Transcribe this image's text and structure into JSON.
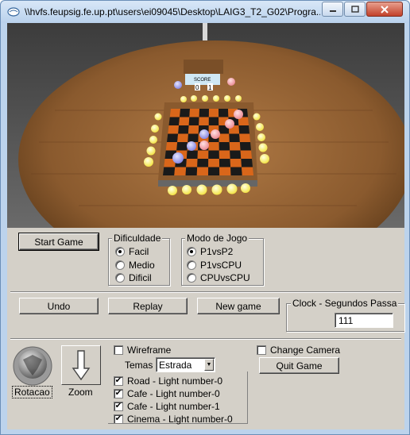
{
  "window": {
    "title": "\\\\hvfs.feupsig.fe.up.pt\\users\\ei09045\\Desktop\\LAIG3_T2_G02\\Progra..."
  },
  "scoreboard": {
    "label": "SCORE",
    "p1": "0",
    "p2": "1"
  },
  "controls": {
    "start_game": "Start Game",
    "undo": "Undo",
    "replay": "Replay",
    "new_game": "New game"
  },
  "difficulty": {
    "title": "Dificuldade",
    "options": [
      "Facil",
      "Medio",
      "Dificil"
    ],
    "selected": "Facil"
  },
  "mode": {
    "title": "Modo de Jogo",
    "options": [
      "P1vsP2",
      "P1vsCPU",
      "CPUvsCPU"
    ],
    "selected": "P1vsP2"
  },
  "clock": {
    "title": "Clock - Segundos Passa",
    "value": "111"
  },
  "camera": {
    "rotation_label": "Rotacao",
    "zoom_label": "Zoom",
    "change_camera_label": "Change Camera",
    "change_camera_checked": false,
    "quit_game": "Quit Game"
  },
  "display": {
    "wireframe_label": "Wireframe",
    "wireframe_checked": false,
    "themes_label": "Temas",
    "theme_value": "Estrada",
    "lights": [
      {
        "label": "Road - Light number-0",
        "checked": true
      },
      {
        "label": "Cafe - Light number-0",
        "checked": true
      },
      {
        "label": "Cafe - Light number-1",
        "checked": true
      },
      {
        "label": "Cinema - Light number-0",
        "checked": true
      }
    ]
  },
  "colors": {
    "window_frame": "#bcd3ec",
    "panel_bg": "#d4d0c8",
    "table_wood": "#8a5a2e",
    "board_orange": "#d9661a",
    "board_dark": "#1a1a1a",
    "piece_pink": "#f5a0a8",
    "piece_blue": "#a8a8f5",
    "light_yellow": "#ffff7a"
  }
}
